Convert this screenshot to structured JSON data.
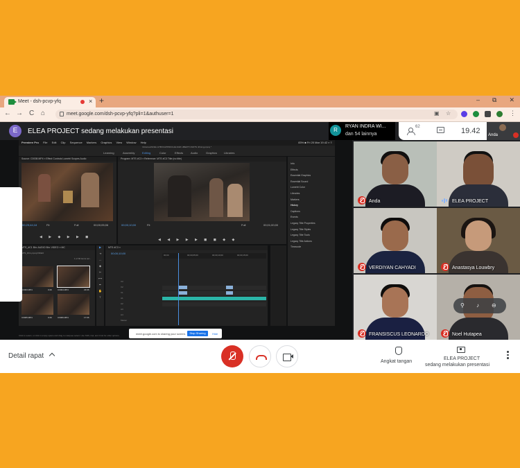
{
  "browser": {
    "tab_title": "Meet - dsh-pcvp-yfq",
    "new_tab": "+",
    "url": "meet.google.com/dsh-pcvp-yfq?pli=1&authuser=1",
    "window_controls": [
      "–",
      "⧉",
      "✕"
    ],
    "nav": [
      "←",
      "→",
      "C",
      "⌂"
    ]
  },
  "meeting": {
    "presenter_initial": "E",
    "presenter_banner": "ELEA PROJECT sedang melakukan presentasi",
    "recording_owner_initial": "R",
    "recording_owner": "RYAN INDRA WI...",
    "recording_others": "dan 54 lainnya",
    "people_count": "62",
    "time": "19.42",
    "self_label": "Anda"
  },
  "shared_screen": {
    "app_menu": [
      "Premiere Pro",
      "File",
      "Edit",
      "Clip",
      "Sequence",
      "Markers",
      "Graphics",
      "View",
      "Window",
      "Help"
    ],
    "status_right": "83% ■  Fri 20 Mar 19.42  ⌕  ≡",
    "project_title": "/Volumes/NOEL HTB/ICAPPROCHE 2020 LIBERTY/ADITS 46 Eng.prproj *",
    "workspaces": [
      "Learning",
      "Assembly",
      "Editing",
      "Color",
      "Effects",
      "Audio",
      "Graphics",
      "Libraries"
    ],
    "source_panel_title": "Source: C0008.MP4 ≡   Effect Controls   Lumetri Scopes   Audio",
    "program_panel_title": "Program: MTS #C3 ≡   Reference: MTS #C3   Title (no title)",
    "source_timecode": "00;25;44;18",
    "source_fit": "Fit",
    "source_full": "Full",
    "source_end": "00;00;05;06",
    "program_timecode": "00;00;10;00",
    "program_fit": "Fit",
    "program_full": "Full",
    "program_end": "00;01;00;00",
    "effects_items": [
      "Info",
      "Effects",
      "Essential Graphics",
      "Essential Sound",
      "Lumetri Color",
      "Libraries",
      "Markers",
      "History",
      "Captions",
      "Events",
      "Legacy Title Properties",
      "Legacy Title Styles",
      "Legacy Title Tools",
      "Legacy Title Actions",
      "Timecode"
    ],
    "project_panel_title": "MTS_#C1   Bin: AUDIO   Bin: VIDEO ≡   MC",
    "project_path": "MTS_#C1.prproj/VIDEO",
    "project_count": "1 of 66 items sel...",
    "thumbnails": [
      {
        "name": "C0003.MP4",
        "dur": "0:26"
      },
      {
        "name": "C0004.MP4",
        "dur": "23:06"
      },
      {
        "name": "C0005.MP4",
        "dur": "0:26"
      },
      {
        "name": "C0006.MP4",
        "dur": "17:06"
      }
    ],
    "timeline_title": "MTS #C3 ≡",
    "timeline_timecode": "00;00;10;00",
    "ruler": [
      "00;00",
      "00;00;05;00",
      "00;00;10;00",
      "00;00;15;00"
    ],
    "tracks": [
      "V3",
      "V2",
      "V1",
      "A1",
      "A2",
      "A3",
      "A4",
      "Master"
    ],
    "tools": [
      "▶",
      "⇥",
      "↔",
      "◆",
      "✂",
      "⟷",
      "✒",
      "✋",
      "T"
    ],
    "share_message": "meet.google.com is sharing your screen.",
    "share_stop": "Stop Sharing",
    "share_hide": "Hide",
    "status": "Click to select, or click in empty space and drag to marquee select. Use Shift, Opt, and Cmd for other options."
  },
  "participants": [
    {
      "name": "Anda",
      "mic": "off"
    },
    {
      "name": "ELEA PROJECT",
      "mic": "speaking"
    },
    {
      "name": "VERDIYAN CAHYADI",
      "mic": "off"
    },
    {
      "name": "Anastasya Louwbry",
      "mic": "off"
    },
    {
      "name": "FRANSISCUS LEONARDO",
      "mic": "off"
    },
    {
      "name": "Noel Hutapea",
      "mic": "off"
    }
  ],
  "bottom_bar": {
    "details": "Detail rapat",
    "raise_hand": "Angkat tangan",
    "presenter_name": "ELEA PROJECT",
    "presenter_status": "sedang melakukan presentasi"
  },
  "colors": {
    "background": "#F7A520",
    "meet_dark": "#202124",
    "mic_off": "#D93025",
    "accent_blue": "#1A73E8"
  }
}
